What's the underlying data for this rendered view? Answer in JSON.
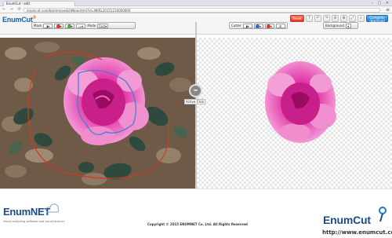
{
  "browser": {
    "tab_title": "EnumCut - edit",
    "url": "enumcut.com/bg/removeEditNew.html?id=NKRL20151210000000",
    "window_controls": "– ▢ ✕",
    "nav_arrows": "← → ⟳",
    "menu_glyph": "≡"
  },
  "header": {
    "logo_main": "EnumCut",
    "logo_mark": "®",
    "reset_label": "Reset",
    "complete_label_1": "Complete",
    "complete_label_2": "download"
  },
  "left_toolbar": {
    "mask_label": "Mask",
    "mode_label": "Mode",
    "mode_value": "Fast"
  },
  "right_toolbar": {
    "cutter_label": "Cutter",
    "background_label": "Background"
  },
  "canvas": {
    "active_click_label": "Active Click",
    "knob_glyph": "–"
  },
  "footer": {
    "enumnet_logo": "EnumNET",
    "tagline": "Visual analyzing   software and cloud services",
    "copyright": "Copyright © 2015 ENUMNET Co. Ltd. All Rights Reserved",
    "enumcut_logo": "EnumCut",
    "site_url": "http://www.enumcut.com"
  },
  "colors": {
    "brand_blue": "#1e4a85",
    "accent_red": "#e0381c",
    "complete_blue": "#1f78c8",
    "flower_pink": "#e23aa8"
  }
}
